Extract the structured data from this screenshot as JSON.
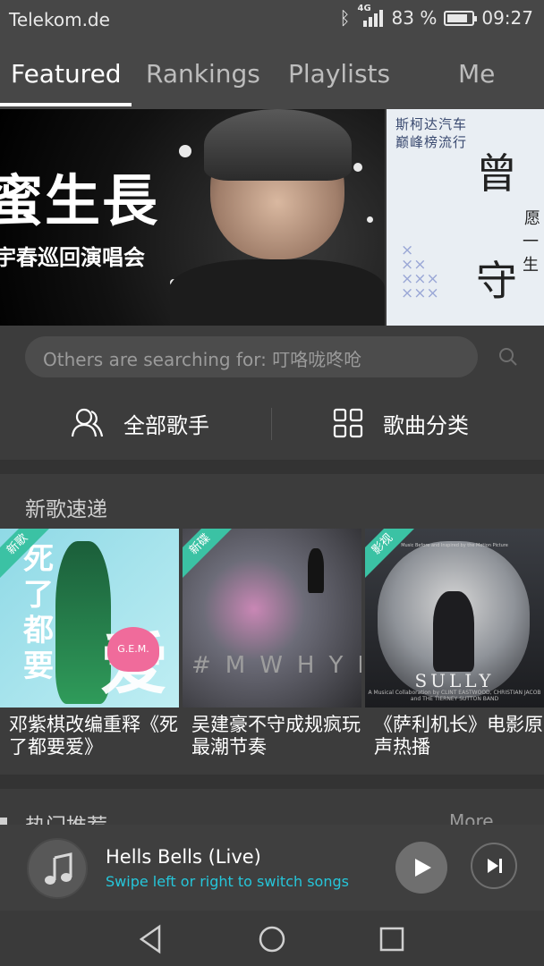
{
  "status_bar": {
    "carrier": "Telekom.de",
    "network": "4G",
    "battery": "83 %",
    "battery_level": 0.83,
    "time": "09:27",
    "icons": [
      "bluetooth-icon",
      "signal-icon",
      "battery-icon"
    ]
  },
  "tabs": [
    {
      "label": "Featured",
      "active": true
    },
    {
      "label": "Rankings",
      "active": false
    },
    {
      "label": "Playlists",
      "active": false
    },
    {
      "label": "Me",
      "active": false
    }
  ],
  "banners": [
    {
      "text_big": "蜜生長",
      "text_sub": "宇春巡回演唱会"
    },
    {
      "text_line1": "斯柯达汽车",
      "text_line2": "巅峰榜流行",
      "text_vertical": "曾 — 守",
      "text_side": "愿 一生"
    }
  ],
  "search": {
    "placeholder": "Others are searching for: 叮咯咙咚呛"
  },
  "categories": [
    {
      "label": "全部歌手",
      "icon": "artists-icon"
    },
    {
      "label": "歌曲分类",
      "icon": "grid-icon"
    }
  ],
  "new_songs": {
    "title": "新歌速递",
    "items": [
      {
        "tag": "新歌",
        "caption": "邓紫棋改编重释《死了都要爱》",
        "cover_text": "死了都要",
        "cover_char": "爱",
        "cover_badge": "G.E.M."
      },
      {
        "tag": "新碟",
        "caption": "吴建豪不守成规疯玩最潮节奏",
        "cover_text": "#MWHYB"
      },
      {
        "tag": "影视",
        "caption": "《萨利机长》电影原声热播",
        "cover_text": "SULLY",
        "cover_tagline": "Music Before and Inspired by the Motion Picture",
        "cover_credits": "A Musical Collaboration by CLINT EASTWOOD, CHRISTIAN JACOB and THE TIERNEY SUTTON BAND"
      }
    ]
  },
  "hot_section": {
    "title": "热门推荐",
    "more": "More"
  },
  "player": {
    "song": "Hells Bells (Live)",
    "hint": "Swipe left or right to switch songs"
  },
  "navbar": [
    "back-icon",
    "home-icon",
    "recents-icon"
  ],
  "colors": {
    "accent": "#26c6da",
    "tag": "#3bc2a4",
    "background": "#3c3c3c"
  }
}
